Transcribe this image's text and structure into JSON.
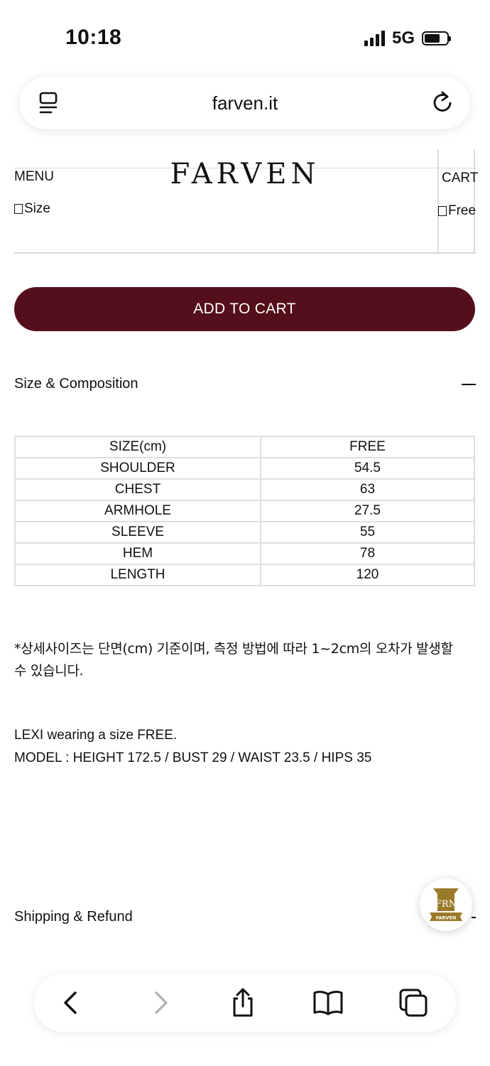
{
  "status_bar": {
    "time": "10:18",
    "network": "5G"
  },
  "browser": {
    "url": "farven.it"
  },
  "site_header": {
    "menu_label": "MENU",
    "logo_text": "FARVEN",
    "cart_label": "CART"
  },
  "product": {
    "size_label": "Size",
    "size_value": "Free",
    "add_to_cart_label": "ADD TO CART"
  },
  "size_composition": {
    "title": "Size & Composition",
    "table": [
      [
        "SIZE(cm)",
        "FREE"
      ],
      [
        "SHOULDER",
        "54.5"
      ],
      [
        "CHEST",
        "63"
      ],
      [
        "ARMHOLE",
        "27.5"
      ],
      [
        "SLEEVE",
        "55"
      ],
      [
        "HEM",
        "78"
      ],
      [
        "LENGTH",
        "120"
      ]
    ],
    "note": "*상세사이즈는 단면(cm) 기준이며, 측정 방법에 따라 1~2cm의 오차가 발생할 수 있습니다.",
    "model_line1": "LEXI wearing a size FREE.",
    "model_line2": "MODEL : HEIGHT 172.5 / BUST 29 / WAIST 23.5 / HIPS 35"
  },
  "shipping": {
    "title": "Shipping & Refund"
  },
  "badge": {
    "top_text": "FRN",
    "ribbon_text": "FARVEN"
  },
  "colors": {
    "accent": "#550e1b",
    "badge_gold": "#9a7a2a"
  }
}
